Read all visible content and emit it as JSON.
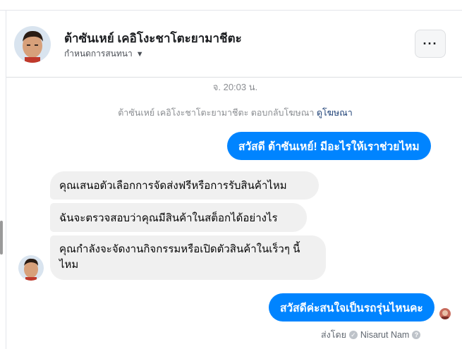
{
  "header": {
    "contact_name": "ต้าซันเหย์ เคอิโงะชาโตะยามาชีตะ",
    "subtitle": "กำหนดการสนทนา",
    "more_label": "···"
  },
  "timestamp": "จ. 20:03 น.",
  "ad_reply": {
    "text": "ต้าซันเหย์ เคอิโงะชาโตะยามาชีตะ ตอบกลับโฆษณา",
    "link": "ดูโฆษณา"
  },
  "messages": [
    {
      "from": "page",
      "text": "สวัสดี ต้าซันเหย์! มีอะไรให้เราช่วยไหม"
    },
    {
      "from": "contact",
      "text": "คุณเสนอตัวเลือกการจัดส่งฟรีหรือการรับสินค้าไหม"
    },
    {
      "from": "contact",
      "text": "ฉันจะตรวจสอบว่าคุณมีสินค้าในสต็อกได้อย่างไร"
    },
    {
      "from": "contact",
      "text": "คุณกำลังจะจัดงานกิจกรรมหรือเปิดตัวสินค้าในเร็วๆ นี้ไหม"
    },
    {
      "from": "page",
      "text": "สวัสดีค่ะสนใจเป็นรถรุ่นไหนคะ"
    }
  ],
  "sent_by": {
    "label": "ส่งโดย",
    "name": "Nisarut Nam",
    "help": "?"
  },
  "colors": {
    "outgoing_bubble": "#0084ff",
    "incoming_bubble": "#f0f0f0",
    "link": "#1c3f75"
  },
  "icons": [
    "more-icon",
    "caret-down-icon",
    "verified-icon",
    "help-icon"
  ]
}
